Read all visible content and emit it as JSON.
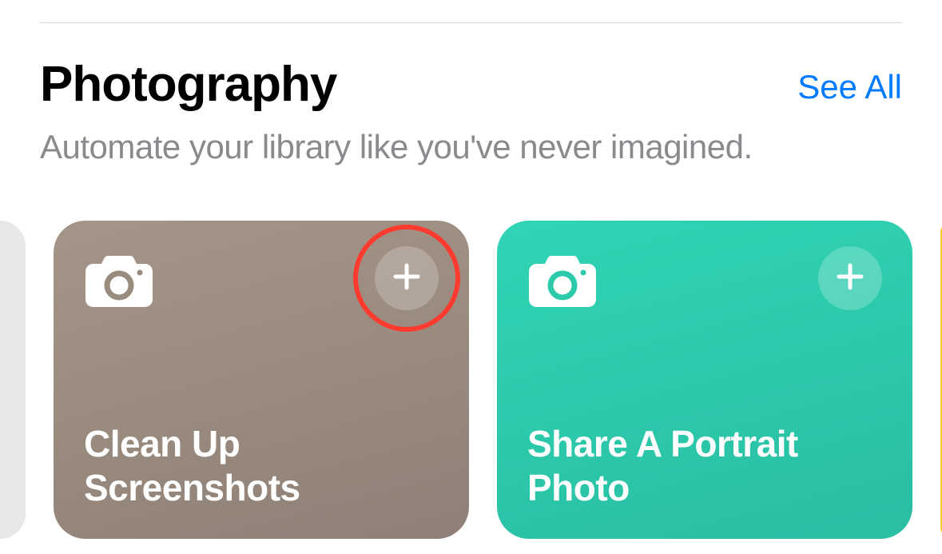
{
  "section": {
    "title": "Photography",
    "seeAll": "See All",
    "subtitle": "Automate your library like you've never imagined."
  },
  "cards": [
    {
      "title": "Clean Up Screenshots",
      "highlighted": true
    },
    {
      "title": "Share A Portrait Photo",
      "highlighted": false
    }
  ],
  "colors": {
    "accent": "#007aff",
    "highlight": "#ff3b30",
    "cardBrown": "#9a8b7f",
    "cardTeal": "#2cc9ab",
    "cardYellow": "#ffc730"
  }
}
